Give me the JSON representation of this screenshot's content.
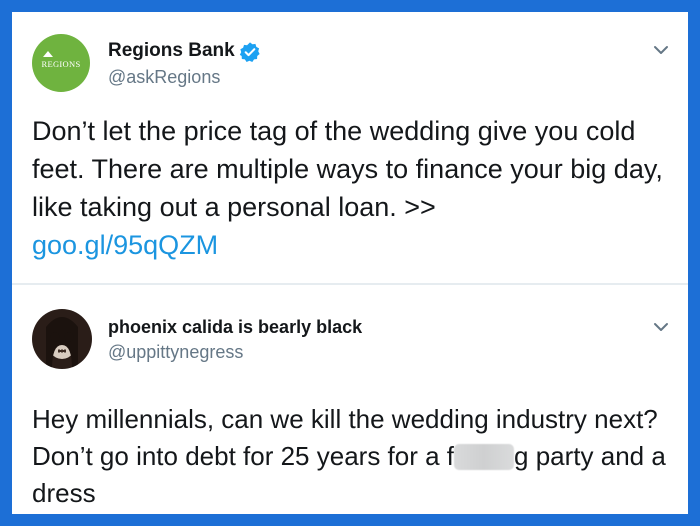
{
  "tweets": [
    {
      "display_name": "Regions Bank",
      "handle": "@askRegions",
      "verified": true,
      "avatar_text": "REGIONS",
      "avatar_color": "#6fb33f",
      "text": "Don’t let the price tag of the wedding give you cold feet. There are multiple ways to finance your big day, like taking out a personal loan. >>",
      "link": "goo.gl/95qQZM"
    },
    {
      "display_name": "phoenix calida is bearly black",
      "handle": "@uppittynegress",
      "verified": false,
      "text_before": "Hey millennials, can we kill the wedding industry next? Don’t go into debt for 25 years for a f",
      "text_after": "g party and a dress"
    }
  ],
  "colors": {
    "frame": "#1d6fd6",
    "link": "#1b95e0",
    "verified": "#1da1f2",
    "secondary_text": "#657786"
  },
  "icons": [
    "verified-badge-icon",
    "chevron-down-icon"
  ]
}
